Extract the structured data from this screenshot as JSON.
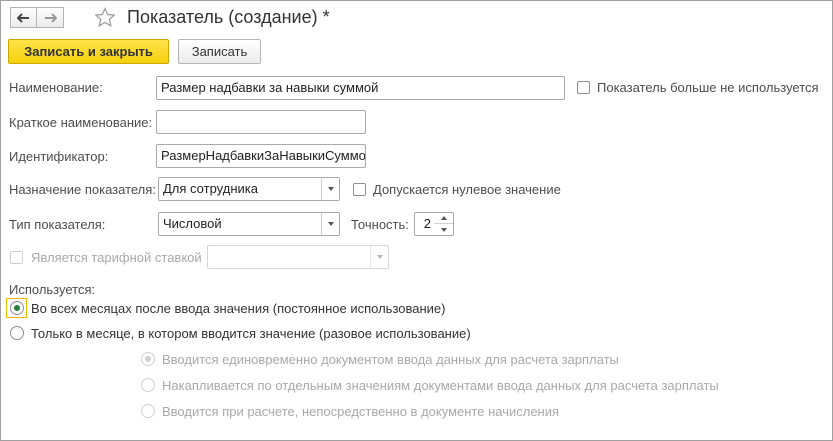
{
  "window": {
    "title": "Показатель (создание) *"
  },
  "toolbar": {
    "save_close_label": "Записать и закрыть",
    "save_label": "Записать"
  },
  "form": {
    "name": {
      "label": "Наименование:",
      "value": "Размер надбавки за навыки суммой"
    },
    "not_used": {
      "label": "Показатель больше не используется",
      "checked": false
    },
    "short_name": {
      "label": "Краткое наименование:",
      "value": ""
    },
    "identifier": {
      "label": "Идентификатор:",
      "value": "РазмерНадбавкиЗаНавыкиСуммой"
    },
    "purpose": {
      "label": "Назначение показателя:",
      "value": "Для сотрудника"
    },
    "zero_allowed": {
      "label": "Допускается нулевое значение",
      "checked": false
    },
    "type": {
      "label": "Тип показателя:",
      "value": "Числовой"
    },
    "precision": {
      "label": "Точность:",
      "value": "2"
    },
    "tariff_rate": {
      "label": "Является тарифной ставкой",
      "checked": false,
      "value": ""
    },
    "usage": {
      "label": "Используется:",
      "options": [
        {
          "label": "Во всех месяцах после ввода значения (постоянное использование)",
          "selected": true
        },
        {
          "label": "Только в месяце, в котором вводится значение (разовое использование)",
          "selected": false
        }
      ],
      "sub_options": [
        {
          "label": "Вводится единовременно документом ввода данных для расчета зарплаты",
          "selected": true
        },
        {
          "label": "Накапливается по отдельным значениям документами ввода данных для расчета зарплаты",
          "selected": false
        },
        {
          "label": "Вводится при расчете, непосредственно в документе начисления",
          "selected": false
        }
      ]
    }
  },
  "colors": {
    "primary_button": "#f7d10c",
    "radio_selected": "#2a7d3a",
    "focus_outline": "#f0c000"
  }
}
